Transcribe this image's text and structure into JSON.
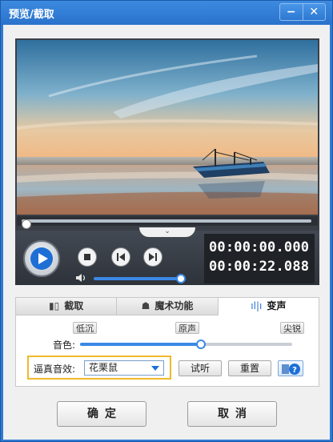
{
  "window": {
    "title": "预览/截取",
    "minimize_label": "−",
    "close_label": "✕"
  },
  "player": {
    "progress": 0,
    "collapse_label": "⌄",
    "volume": 1,
    "time_current": "00:00:00.000",
    "time_total": "00:00:22.088"
  },
  "tabs": [
    {
      "label": "截取",
      "icon": "film-icon",
      "glyph": "▮▯",
      "active": false
    },
    {
      "label": "魔术功能",
      "icon": "magic-hat-icon",
      "glyph": "☗",
      "active": false
    },
    {
      "label": "变声",
      "icon": "sound-wave-icon",
      "glyph": "ıl|ı",
      "active": true
    }
  ],
  "voice": {
    "pitch_label": "音色:",
    "mark_low": "低沉",
    "mark_original": "原声",
    "mark_high": "尖锐",
    "pitch_level": 0.57,
    "effect_label": "逼真音效:",
    "effect_value": "花栗鼠",
    "try_label": "试听",
    "reset_label": "重置",
    "help_icon": "help-icon"
  },
  "footer": {
    "ok_label": "确定",
    "cancel_label": "取消"
  },
  "colors": {
    "titlebar": "#2e7ad3",
    "accent": "#1d6fd6",
    "highlight_border": "#f0b92a"
  }
}
